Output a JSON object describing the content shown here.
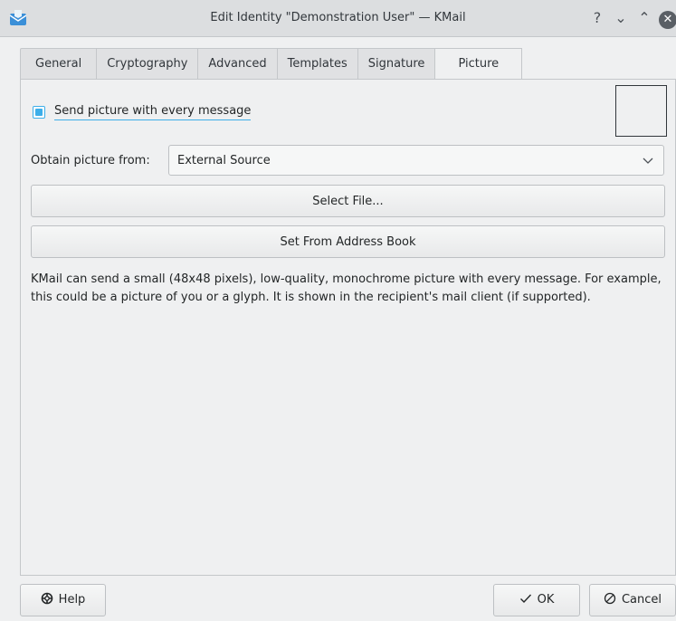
{
  "window": {
    "title": "Edit Identity \"Demonstration User\" — KMail",
    "controls": {
      "help": "?",
      "minimize": "⌄",
      "maximize": "⌃",
      "close": "✕"
    }
  },
  "tabs": [
    {
      "label": "General"
    },
    {
      "label": "Cryptography"
    },
    {
      "label": "Advanced"
    },
    {
      "label": "Templates"
    },
    {
      "label": "Signature"
    },
    {
      "label": "Picture",
      "active": true
    }
  ],
  "picture_tab": {
    "send_picture_checkbox": {
      "label": "Send picture with every message",
      "checked": true
    },
    "obtain_label": "Obtain picture from:",
    "obtain_select": {
      "value": "External Source"
    },
    "select_file_button": "Select File...",
    "address_book_button": "Set From Address Book",
    "description": "KMail can send a small (48x48 pixels), low-quality, monochrome picture with every message. For example, this could be a picture of you or a glyph. It is shown in the recipient's mail client (if supported)."
  },
  "footer": {
    "help_label": "Help",
    "ok_label": "OK",
    "cancel_label": "Cancel"
  },
  "icons": {
    "app": "kmail-icon",
    "help": "help-icon",
    "ok": "checkmark-icon",
    "cancel": "cancel-icon",
    "dropdown": "chevron-down-icon"
  },
  "colors": {
    "accent": "#3daee9",
    "background": "#eff0f1",
    "text": "#232627"
  }
}
